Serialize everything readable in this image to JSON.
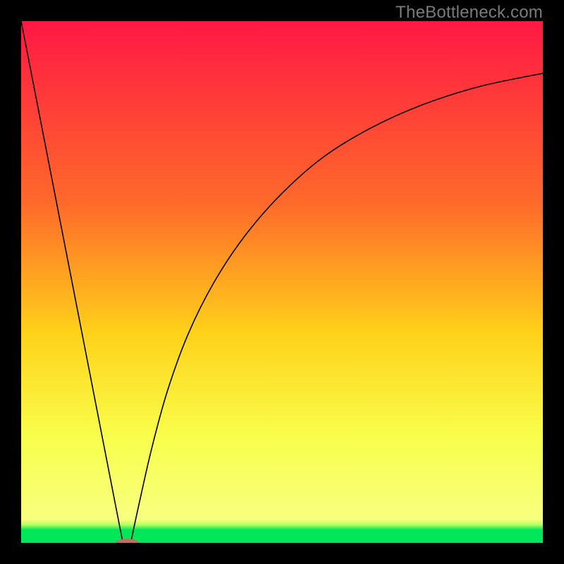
{
  "attribution": "TheBottleneck.com",
  "colors": {
    "black_border": "#000000",
    "gradient_top": "#ff1844",
    "gradient_mid1": "#ff6a2a",
    "gradient_mid2": "#ffd21a",
    "gradient_mid3": "#f8ff4c",
    "gradient_green": "#00e85a",
    "curve_stroke": "#000000",
    "marker_fill": "#cb6a64"
  },
  "chart_data": {
    "type": "line",
    "title": "",
    "xlabel": "",
    "ylabel": "",
    "xlim": [
      0,
      100
    ],
    "ylim": [
      0,
      100
    ],
    "gradient_stops": [
      {
        "offset": 0.0,
        "color": "#ff1844"
      },
      {
        "offset": 0.35,
        "color": "#ff6a2a"
      },
      {
        "offset": 0.6,
        "color": "#ffd21a"
      },
      {
        "offset": 0.8,
        "color": "#f8ff4c"
      },
      {
        "offset": 0.955,
        "color": "#f8ff80"
      },
      {
        "offset": 0.965,
        "color": "#b8ff60"
      },
      {
        "offset": 0.975,
        "color": "#00e85a"
      },
      {
        "offset": 1.0,
        "color": "#00e85a"
      }
    ],
    "series": [
      {
        "name": "left-line",
        "x": [
          0.0,
          19.5
        ],
        "y": [
          100.0,
          0.0
        ]
      },
      {
        "name": "right-curve",
        "x": [
          21.0,
          22.5,
          25.0,
          28.0,
          32.0,
          37.0,
          43.0,
          50.0,
          58.0,
          67.0,
          77.0,
          88.0,
          100.0
        ],
        "y": [
          0.0,
          7.0,
          18.0,
          29.0,
          40.0,
          50.0,
          59.0,
          67.0,
          74.0,
          79.5,
          84.0,
          87.5,
          90.0
        ]
      }
    ],
    "marker": {
      "name": "trough-marker",
      "x": 20.3,
      "y": 0.0,
      "rx_pct": 2.2,
      "ry_pct": 0.8
    }
  }
}
